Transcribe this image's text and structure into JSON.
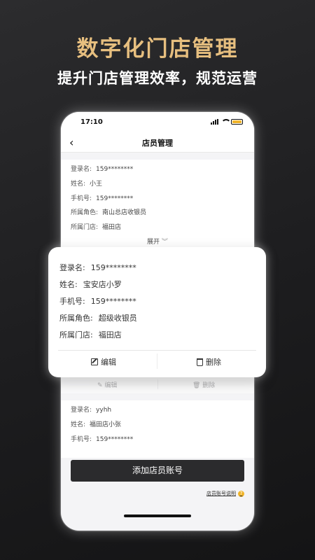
{
  "hero": {
    "title": "数字化门店管理",
    "subtitle": "提升门店管理效率，规范运营"
  },
  "status_bar": {
    "time": "17:10"
  },
  "nav": {
    "back_icon": "chevron-left-icon",
    "title": "店员管理"
  },
  "card1": {
    "rows": [
      {
        "label": "登录名:",
        "value": "159********"
      },
      {
        "label": "姓名:",
        "value": "小王"
      },
      {
        "label": "手机号:",
        "value": "159********"
      },
      {
        "label": "所属角色:",
        "value": "南山总店收银员"
      },
      {
        "label": "所属门店:",
        "value": "福田店"
      }
    ],
    "expand_label": "展开"
  },
  "popup": {
    "rows": [
      {
        "label": "登录名:",
        "value": "159********"
      },
      {
        "label": "姓名:",
        "value": "宝安店小罗"
      },
      {
        "label": "手机号:",
        "value": "159********"
      },
      {
        "label": "所属角色:",
        "value": "超级收银员"
      },
      {
        "label": "所属门店:",
        "value": "福田店"
      }
    ],
    "edit_label": "编辑",
    "delete_label": "删除"
  },
  "ghost_actions": {
    "edit_label": "编辑",
    "delete_label": "删除"
  },
  "card3": {
    "rows": [
      {
        "label": "登录名:",
        "value": "yyhh"
      },
      {
        "label": "姓名:",
        "value": "福田店小张"
      },
      {
        "label": "手机号:",
        "value": "159********"
      }
    ]
  },
  "add_button_label": "添加店员账号",
  "help_link": "店员账号说明",
  "colors": {
    "accent_gold": "#e7bf7f",
    "button_dark": "#2b2b2d",
    "help_icon": "#f0b429"
  }
}
